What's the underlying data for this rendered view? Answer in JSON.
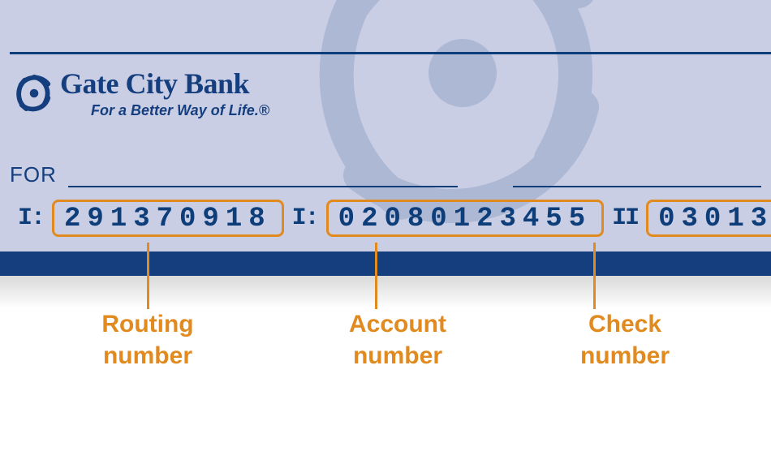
{
  "bank": {
    "name": "Gate City Bank",
    "tagline": "For a Better Way of Life.®"
  },
  "for_label": "FOR",
  "micr": {
    "routing": "291370918",
    "account": "02080123455",
    "check": "03013"
  },
  "callouts": {
    "routing_l1": "Routing",
    "routing_l2": "number",
    "account_l1": "Account",
    "account_l2": "number",
    "check_l1": "Check",
    "check_l2": "number"
  },
  "colors": {
    "navy": "#153e7e",
    "orange": "#e08a1f",
    "check_bg": "#c9cee4"
  }
}
